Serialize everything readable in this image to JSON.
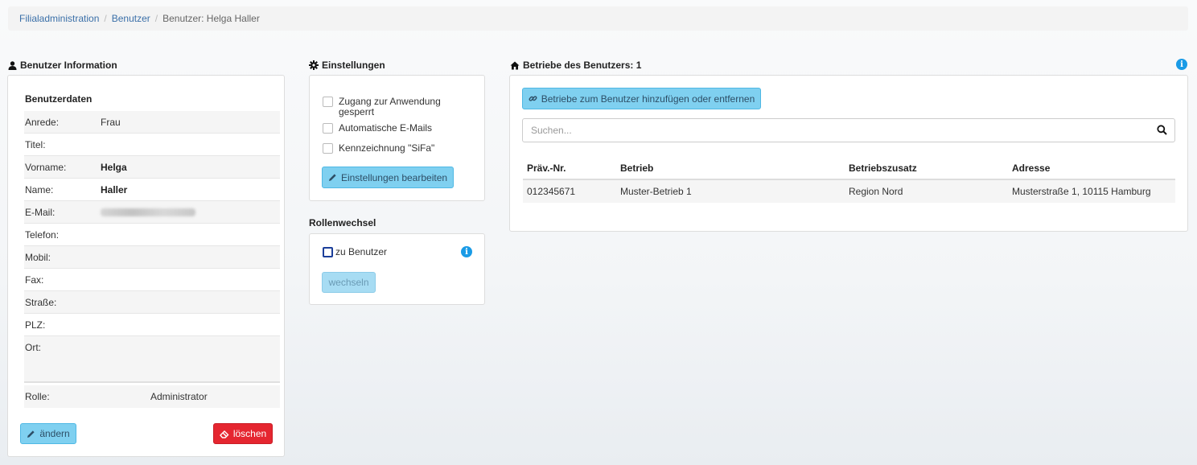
{
  "breadcrumb": {
    "items": [
      {
        "label": "Filialadministration"
      },
      {
        "label": "Benutzer"
      }
    ],
    "current": "Benutzer: Helga Haller",
    "separator": "/"
  },
  "user_info": {
    "title": "Benutzer Information",
    "icon": "user-icon",
    "section": "Benutzerdaten",
    "fields": [
      {
        "label": "Anrede:",
        "value": "Frau"
      },
      {
        "label": "Titel:",
        "value": ""
      },
      {
        "label": "Vorname:",
        "value": "Helga"
      },
      {
        "label": "Name:",
        "value": "Haller"
      },
      {
        "label": "E-Mail:",
        "value": ""
      },
      {
        "label": "Telefon:",
        "value": ""
      },
      {
        "label": "Mobil:",
        "value": ""
      },
      {
        "label": "Fax:",
        "value": ""
      },
      {
        "label": "Straße:",
        "value": ""
      },
      {
        "label": "PLZ:",
        "value": ""
      },
      {
        "label": "Ort:",
        "value": ""
      }
    ],
    "role_label": "Rolle:",
    "role_value": "Administrator",
    "edit_label": "ändern",
    "delete_label": "löschen"
  },
  "settings": {
    "title": "Einstellungen",
    "icon": "gear-icon",
    "options": [
      {
        "label": "Zugang zur Anwendung gesperrt",
        "checked": false
      },
      {
        "label": "Automatische E-Mails",
        "checked": false
      },
      {
        "label": "Kennzeichnung \"SiFa\"",
        "checked": false
      }
    ],
    "edit_label": "Einstellungen bearbeiten"
  },
  "role_switch": {
    "title": "Rollenwechsel",
    "option_label": "zu Benutzer",
    "button_label": "wechseln"
  },
  "firms": {
    "title": "Betriebe des Benutzers: 1",
    "icon": "home-icon",
    "add_label": "Betriebe zum Benutzer hinzufügen oder entfernen",
    "search_placeholder": "Suchen...",
    "columns": [
      "Präv.-Nr.",
      "Betrieb",
      "Betriebszusatz",
      "Adresse"
    ],
    "rows": [
      [
        "012345671",
        "Muster-Betrieb 1",
        "Region Nord",
        "Musterstraße 1, 10115 Hamburg"
      ]
    ]
  },
  "colors": {
    "link": "#3a6fa8",
    "info_button": "#7fd0f0",
    "danger_button": "#e52630",
    "info_icon": "#1a9be6"
  }
}
